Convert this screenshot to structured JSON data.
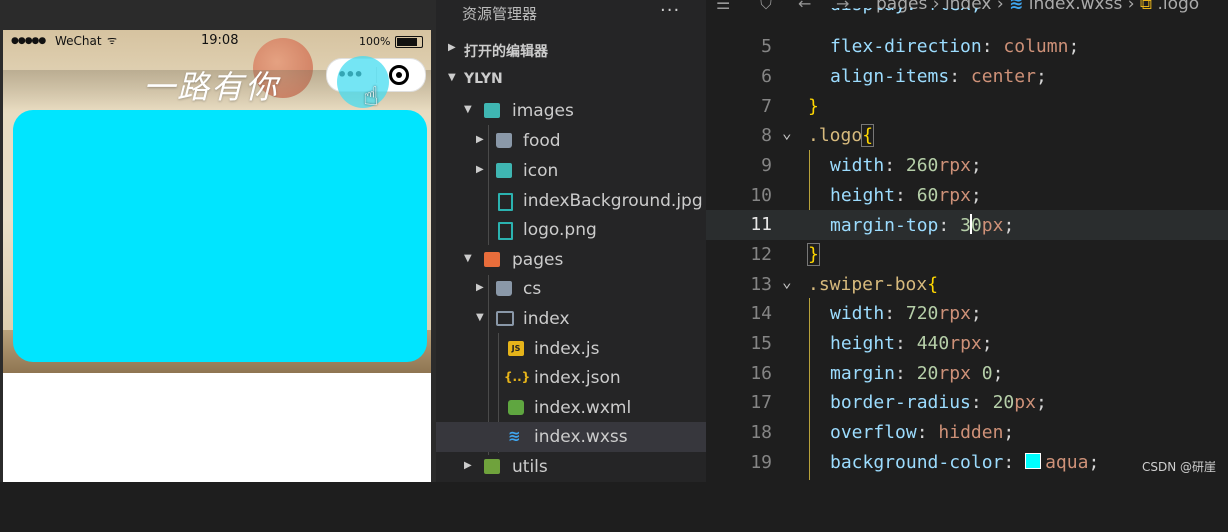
{
  "simulator": {
    "carrier": "WeChat",
    "time": "19:08",
    "battery": "100%",
    "logo_text": "一路有你",
    "swiper_color": "#00e5ff"
  },
  "explorer": {
    "title": "资源管理器",
    "more": "···",
    "open_editors": "打开的编辑器",
    "project": "YLYN",
    "tree": [
      {
        "label": "images",
        "icon": "folder-image-icon"
      },
      {
        "label": "food",
        "icon": "folder-icon"
      },
      {
        "label": "icon",
        "icon": "folder-image-icon"
      },
      {
        "label": "indexBackground.jpg",
        "icon": "image-file-icon"
      },
      {
        "label": "logo.png",
        "icon": "image-file-icon"
      },
      {
        "label": "pages",
        "icon": "folder-pages-icon"
      },
      {
        "label": "cs",
        "icon": "folder-icon"
      },
      {
        "label": "index",
        "icon": "folder-open-icon"
      },
      {
        "label": "index.js",
        "icon": "js-file-icon"
      },
      {
        "label": "index.json",
        "icon": "json-file-icon"
      },
      {
        "label": "index.wxml",
        "icon": "wxml-file-icon"
      },
      {
        "label": "index.wxss",
        "icon": "wxss-file-icon"
      },
      {
        "label": "utils",
        "icon": "folder-utils-icon"
      }
    ]
  },
  "editor": {
    "breadcrumb": [
      "pages",
      "index",
      "index.wxss",
      ".logo"
    ],
    "lines": [
      {
        "n": "5",
        "text": "flex-direction: column;"
      },
      {
        "n": "6",
        "text": "align-items: center;"
      },
      {
        "n": "7",
        "text": "}"
      },
      {
        "n": "8",
        "text": ".logo{"
      },
      {
        "n": "9",
        "text": "width: 260rpx;"
      },
      {
        "n": "10",
        "text": "height: 60rpx;"
      },
      {
        "n": "11",
        "text": "margin-top: 30px;"
      },
      {
        "n": "12",
        "text": "}"
      },
      {
        "n": "13",
        "text": ".swiper-box{"
      },
      {
        "n": "14",
        "text": "width: 720rpx;"
      },
      {
        "n": "15",
        "text": "height: 440rpx;"
      },
      {
        "n": "16",
        "text": "margin: 20rpx 0;"
      },
      {
        "n": "17",
        "text": "border-radius: 20px;"
      },
      {
        "n": "18",
        "text": "overflow: hidden;"
      },
      {
        "n": "19",
        "text": "background-color: aqua;"
      }
    ],
    "partial_top": "display: flex;"
  },
  "watermark": "CSDN @研崖"
}
